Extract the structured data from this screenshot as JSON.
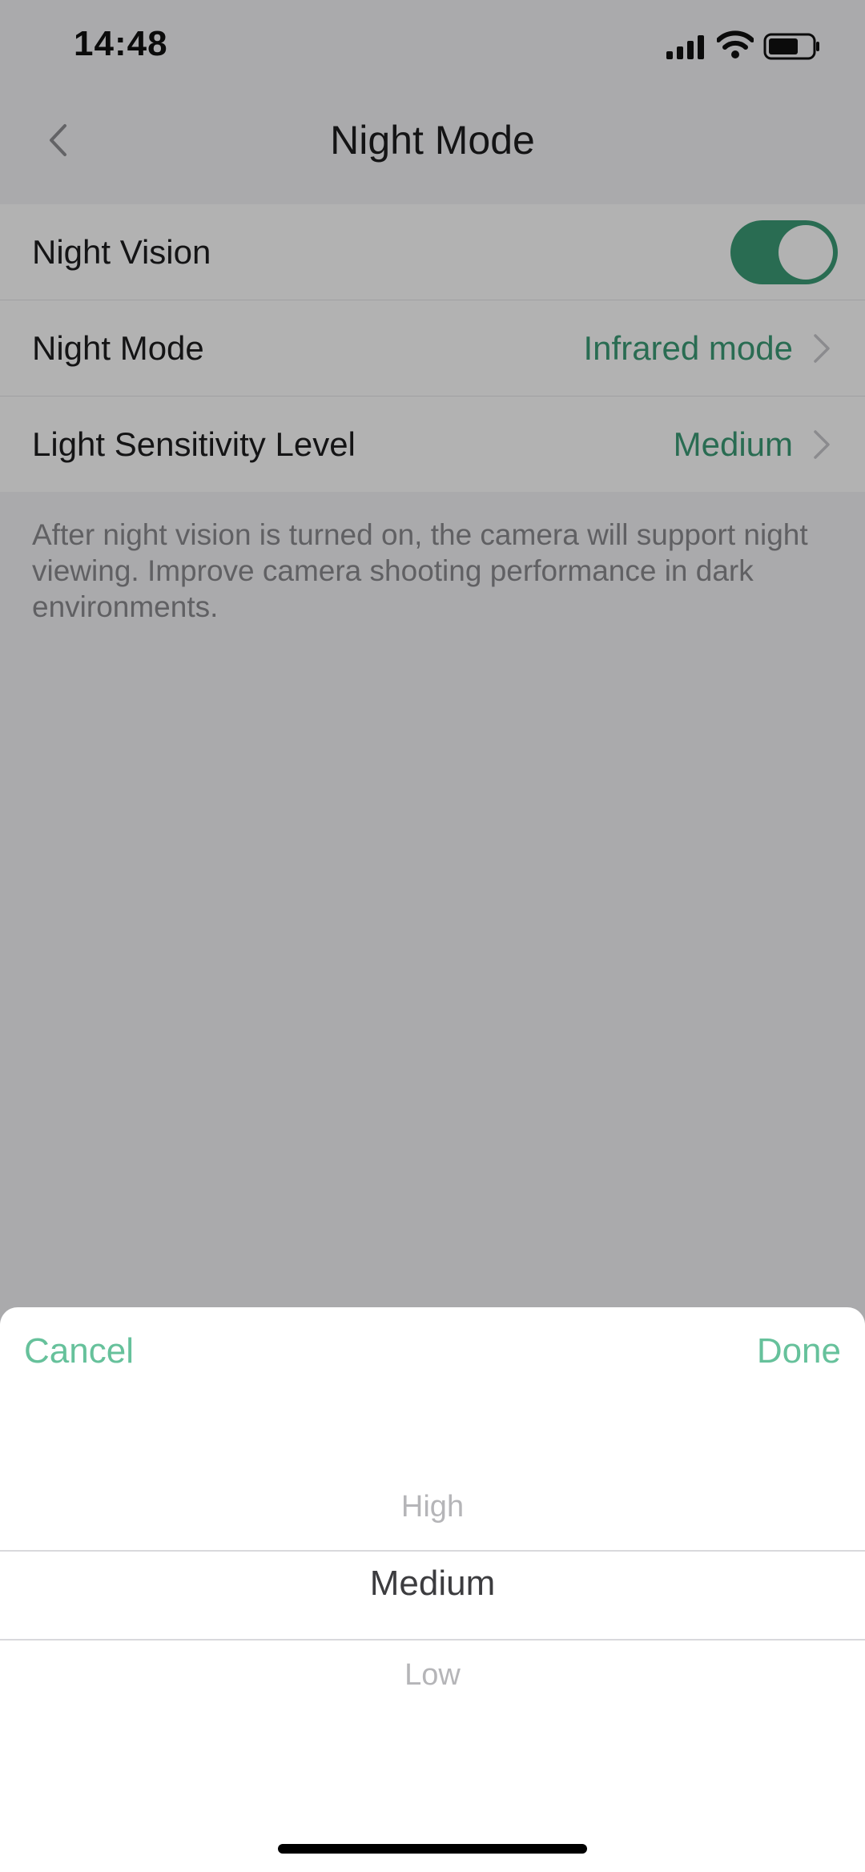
{
  "status_bar": {
    "time": "14:48",
    "icons": [
      "signal-icon",
      "wifi-icon",
      "battery-icon"
    ]
  },
  "nav": {
    "title": "Night Mode",
    "back_icon": "chevron-left-icon"
  },
  "settings": {
    "night_vision": {
      "label": "Night Vision",
      "enabled": true
    },
    "night_mode": {
      "label": "Night Mode",
      "value": "Infrared mode"
    },
    "light_sensitivity": {
      "label": "Light Sensitivity Level",
      "value": "Medium"
    }
  },
  "footnote": "After night vision is turned on, the camera will support night viewing. Improve camera shooting performance in dark environments.",
  "picker": {
    "cancel_label": "Cancel",
    "done_label": "Done",
    "options": [
      "High",
      "Medium",
      "Low"
    ],
    "selected": "Medium"
  },
  "colors": {
    "accent": "#3c9b76",
    "accent_light": "#66c19b",
    "background": "#f4f4f6",
    "overlay": "rgba(0,0,0,0.3)"
  }
}
